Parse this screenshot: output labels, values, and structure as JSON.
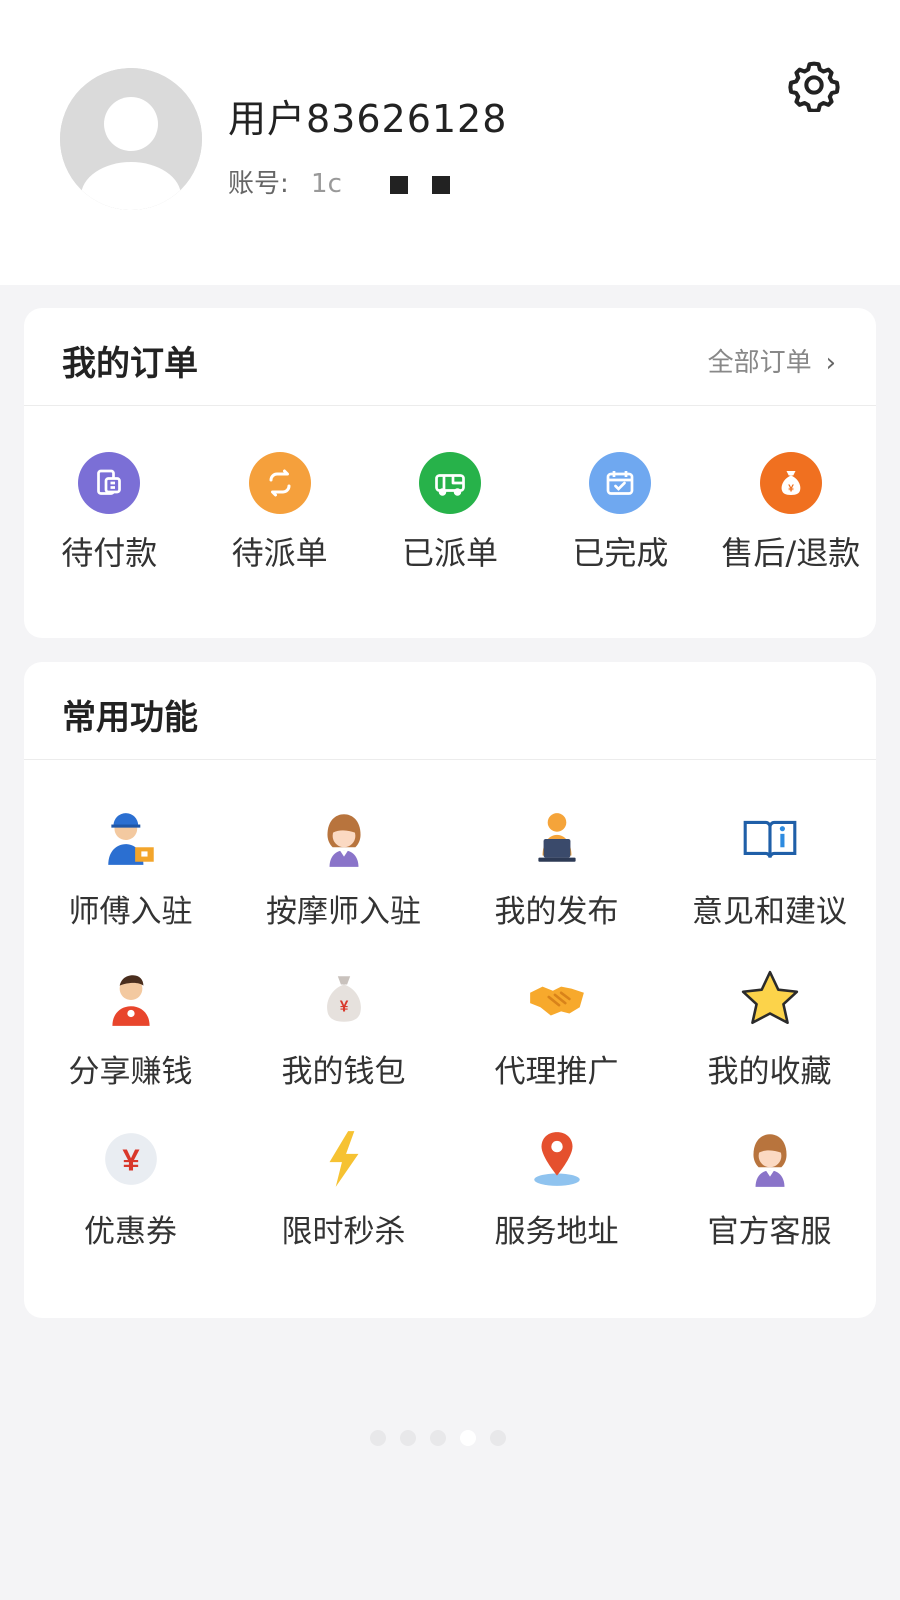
{
  "profile": {
    "username": "用户83626128",
    "account_label": "账号:",
    "account_value": "1c"
  },
  "orders": {
    "title": "我的订单",
    "all_label": "全部订单",
    "items": [
      {
        "label": "待付款",
        "icon": "wallet-icon",
        "color": "#7b6fd6"
      },
      {
        "label": "待派单",
        "icon": "sync-icon",
        "color": "#f5a03c"
      },
      {
        "label": "已派单",
        "icon": "truck-icon",
        "color": "#27b24a"
      },
      {
        "label": "已完成",
        "icon": "calendar-check-icon",
        "color": "#6fa8f0"
      },
      {
        "label": "售后/退款",
        "icon": "money-bag-icon",
        "color": "#f07020"
      }
    ]
  },
  "functions": {
    "title": "常用功能",
    "items": [
      {
        "label": "师傅入驻",
        "icon": "worker-icon"
      },
      {
        "label": "按摩师入驻",
        "icon": "masseuse-icon"
      },
      {
        "label": "我的发布",
        "icon": "person-laptop-icon"
      },
      {
        "label": "意见和建议",
        "icon": "info-book-icon"
      },
      {
        "label": "分享赚钱",
        "icon": "share-person-icon"
      },
      {
        "label": "我的钱包",
        "icon": "money-sack-icon"
      },
      {
        "label": "代理推广",
        "icon": "handshake-icon"
      },
      {
        "label": "我的收藏",
        "icon": "star-icon"
      },
      {
        "label": "优惠券",
        "icon": "yen-coin-icon"
      },
      {
        "label": "限时秒杀",
        "icon": "lightning-icon"
      },
      {
        "label": "服务地址",
        "icon": "location-pin-icon"
      },
      {
        "label": "官方客服",
        "icon": "customer-service-icon"
      }
    ]
  },
  "pager": {
    "count": 5,
    "active": 3
  }
}
